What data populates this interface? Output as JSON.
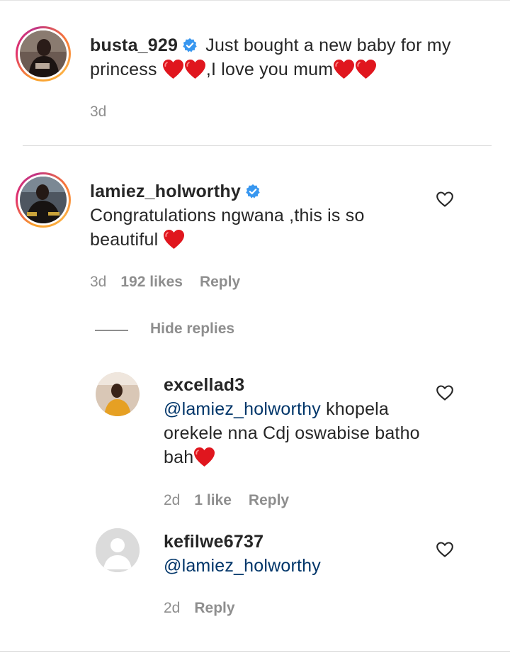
{
  "caption": {
    "username": "busta_929",
    "text_part1": "Just bought a new baby for my princess ",
    "text_part2": ",I love you mum",
    "time": "3d",
    "avatar_icon": "profile-photo"
  },
  "comment": {
    "username": "lamiez_holworthy",
    "text": "Congratulations ngwana ,this is so beautiful ",
    "time": "3d",
    "likes": "192 likes",
    "reply_label": "Reply",
    "hide_replies_label": "Hide replies"
  },
  "replies": [
    {
      "username": "excellad3",
      "mention": "@lamiez_holworthy",
      "text": " khopela orekele nna Cdj oswabise batho bah",
      "time": "2d",
      "likes": "1 like",
      "reply_label": "Reply"
    },
    {
      "username": "kefilwe6737",
      "mention": "@lamiez_holworthy",
      "time": "2d",
      "reply_label": "Reply"
    }
  ],
  "colors": {
    "verified": "#3897f0",
    "heart": "#ed1c24",
    "mention": "#003569",
    "meta": "#8e8e8e"
  }
}
